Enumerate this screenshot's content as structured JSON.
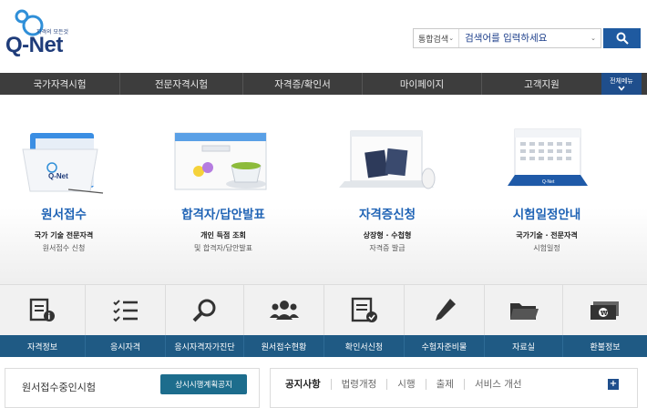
{
  "logo": {
    "tagline": "자격의 모든것",
    "brand": "Q-Net"
  },
  "search": {
    "scope": "통합검색",
    "placeholder": "검색어를 입력하세요"
  },
  "nav": {
    "items": [
      "국가자격시험",
      "전문자격시험",
      "자격증/확인서",
      "마이페이지",
      "고객지원"
    ],
    "allmenu": "전체메뉴"
  },
  "features": [
    {
      "title": "원서접수",
      "sub1": "국가 기술 전문자격",
      "sub2": "원서접수 신청"
    },
    {
      "title": "합격자/답안발표",
      "sub1": "개인 득점 조회",
      "sub2": "및 합격자/답안발표"
    },
    {
      "title": "자격증신청",
      "sub1": "상장형 · 수첩형",
      "sub2": "자격증 발급"
    },
    {
      "title": "시험일정안내",
      "sub1": "국가기술 · 전문자격",
      "sub2": "시험일정"
    }
  ],
  "quick_menu": {
    "icons": [
      "document-info-icon",
      "checklist-icon",
      "magnifier-icon",
      "people-icon",
      "certificate-check-icon",
      "pencil-icon",
      "folder-icon",
      "money-icon"
    ],
    "labels": [
      "자격정보",
      "응시자격",
      "응시자격자가진단",
      "원서접수현황",
      "확인서신청",
      "수험자준비물",
      "자료실",
      "환불정보"
    ]
  },
  "bottom": {
    "left_title": "원서접수중인시험",
    "left_button": "상시시행계획공지",
    "tabs": [
      "공지사항",
      "법령개정",
      "시행",
      "출제",
      "서비스 개선"
    ],
    "more": "+"
  }
}
